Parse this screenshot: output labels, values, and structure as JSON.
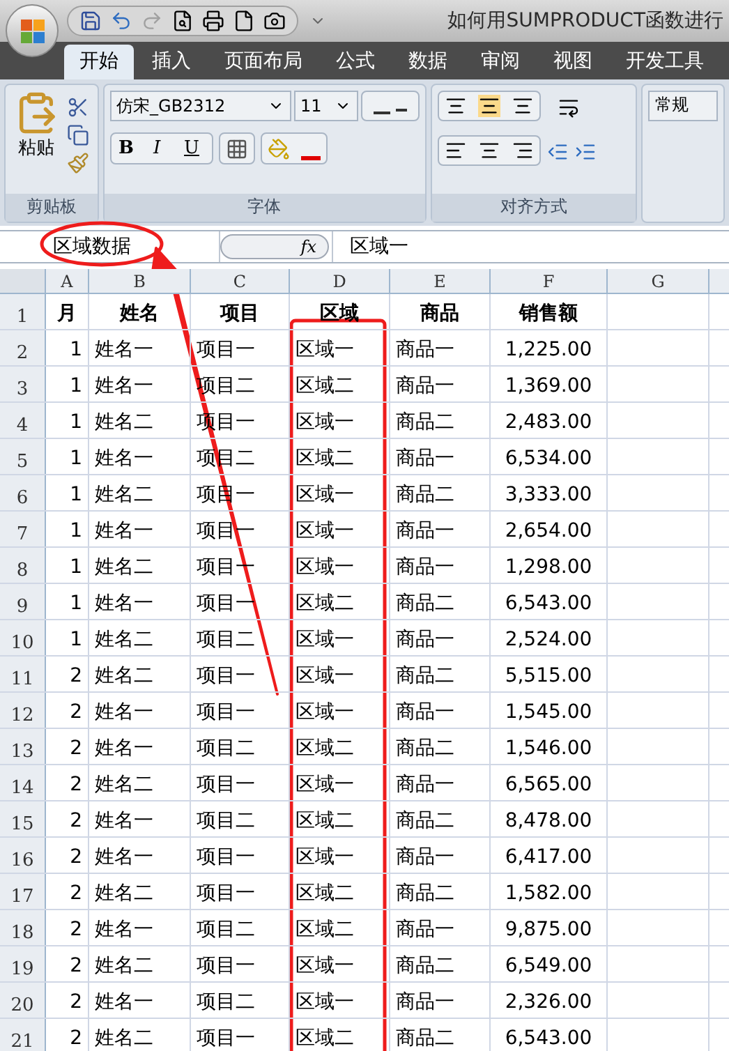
{
  "window": {
    "title": "如何用SUMPRODUCT函数进行"
  },
  "tabs": [
    {
      "label": "开始",
      "selected": true
    },
    {
      "label": "插入",
      "selected": false
    },
    {
      "label": "页面布局",
      "selected": false
    },
    {
      "label": "公式",
      "selected": false
    },
    {
      "label": "数据",
      "selected": false
    },
    {
      "label": "审阅",
      "selected": false
    },
    {
      "label": "视图",
      "selected": false
    },
    {
      "label": "开发工具",
      "selected": false
    }
  ],
  "ribbon": {
    "clipboard": {
      "label": "剪贴板",
      "paste": "粘贴"
    },
    "font": {
      "label": "字体",
      "font_name": "仿宋_GB2312",
      "font_size": "11",
      "bold": "B",
      "italic": "I",
      "underline": "U"
    },
    "alignment": {
      "label": "对齐方式"
    },
    "number": {
      "format": "常规"
    }
  },
  "formula_bar": {
    "name_box": "区域数据",
    "fx_label": "fx",
    "formula": "区域一"
  },
  "sheet": {
    "columns": [
      "A",
      "B",
      "C",
      "D",
      "E",
      "F",
      "G"
    ],
    "header": {
      "number": "1",
      "cells": [
        "月",
        "姓名",
        "项目",
        "区域",
        "商品",
        "销售额"
      ]
    },
    "rows": [
      {
        "number": "2",
        "cells": [
          "1",
          "姓名一",
          "项目一",
          "区域一",
          "商品一",
          "1,225.00"
        ]
      },
      {
        "number": "3",
        "cells": [
          "1",
          "姓名一",
          "项目二",
          "区域二",
          "商品一",
          "1,369.00"
        ]
      },
      {
        "number": "4",
        "cells": [
          "1",
          "姓名二",
          "项目一",
          "区域一",
          "商品二",
          "2,483.00"
        ]
      },
      {
        "number": "5",
        "cells": [
          "1",
          "姓名一",
          "项目二",
          "区域二",
          "商品一",
          "6,534.00"
        ]
      },
      {
        "number": "6",
        "cells": [
          "1",
          "姓名二",
          "项目一",
          "区域一",
          "商品二",
          "3,333.00"
        ]
      },
      {
        "number": "7",
        "cells": [
          "1",
          "姓名一",
          "项目一",
          "区域一",
          "商品一",
          "2,654.00"
        ]
      },
      {
        "number": "8",
        "cells": [
          "1",
          "姓名二",
          "项目一",
          "区域一",
          "商品一",
          "1,298.00"
        ]
      },
      {
        "number": "9",
        "cells": [
          "1",
          "姓名一",
          "项目一",
          "区域二",
          "商品二",
          "6,543.00"
        ]
      },
      {
        "number": "10",
        "cells": [
          "1",
          "姓名二",
          "项目二",
          "区域一",
          "商品一",
          "2,524.00"
        ]
      },
      {
        "number": "11",
        "cells": [
          "2",
          "姓名二",
          "项目一",
          "区域一",
          "商品二",
          "5,515.00"
        ]
      },
      {
        "number": "12",
        "cells": [
          "2",
          "姓名一",
          "项目一",
          "区域一",
          "商品一",
          "1,545.00"
        ]
      },
      {
        "number": "13",
        "cells": [
          "2",
          "姓名一",
          "项目二",
          "区域二",
          "商品二",
          "1,546.00"
        ]
      },
      {
        "number": "14",
        "cells": [
          "2",
          "姓名二",
          "项目一",
          "区域一",
          "商品一",
          "6,565.00"
        ]
      },
      {
        "number": "15",
        "cells": [
          "2",
          "姓名一",
          "项目二",
          "区域二",
          "商品二",
          "8,478.00"
        ]
      },
      {
        "number": "16",
        "cells": [
          "2",
          "姓名一",
          "项目一",
          "区域一",
          "商品一",
          "6,417.00"
        ]
      },
      {
        "number": "17",
        "cells": [
          "2",
          "姓名二",
          "项目一",
          "区域二",
          "商品二",
          "1,582.00"
        ]
      },
      {
        "number": "18",
        "cells": [
          "2",
          "姓名一",
          "项目二",
          "区域二",
          "商品一",
          "9,875.00"
        ]
      },
      {
        "number": "19",
        "cells": [
          "2",
          "姓名二",
          "项目一",
          "区域一",
          "商品二",
          "6,549.00"
        ]
      },
      {
        "number": "20",
        "cells": [
          "2",
          "姓名一",
          "项目二",
          "区域一",
          "商品一",
          "2,326.00"
        ]
      },
      {
        "number": "21",
        "cells": [
          "2",
          "姓名二",
          "项目一",
          "区域二",
          "商品二",
          "6,543.00"
        ]
      }
    ]
  }
}
